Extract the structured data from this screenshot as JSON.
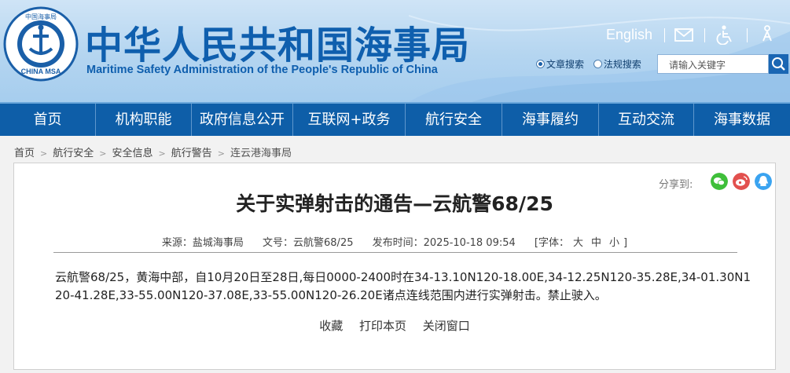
{
  "header": {
    "title_cn": "中华人民共和国海事局",
    "title_en": "Maritime Safety Administration of the People's Republic of China",
    "logo_text": "中国海事局 CHINA MSA",
    "english_link": "English",
    "icons": [
      "mail-icon",
      "accessibility-icon",
      "elder-mode-icon"
    ],
    "search": {
      "option_doc": "文章搜索",
      "option_law": "法规搜索",
      "placeholder": "请输入关键字"
    }
  },
  "nav": {
    "items": [
      "首页",
      "机构职能",
      "政府信息公开",
      "互联网+政务",
      "航行安全",
      "海事履约",
      "互动交流",
      "海事数据"
    ]
  },
  "breadcrumb": {
    "items": [
      "首页",
      "航行安全",
      "安全信息",
      "航行警告",
      "连云港海事局"
    ]
  },
  "article": {
    "share_label": "分享到:",
    "title": "关于实弹射击的通告—云航警68/25",
    "meta": {
      "source": "来源：盐城海事局",
      "doc_no": "文号：云航警68/25",
      "time": "发布时间：2025-10-18 09:54",
      "font_label": "[字体：",
      "font_large": "大",
      "font_medium": "中",
      "font_small": "小",
      "font_end": "]"
    },
    "body": "云航警68/25，黄海中部，自10月20日至28日,每日0000-2400时在34-13.10N120-18.00E,34-12.25N120-35.28E,34-01.30N120-41.28E,33-55.00N120-37.08E,33-55.00N120-26.20E诸点连线范围内进行实弹射击。禁止驶入。",
    "actions": [
      "收藏",
      "打印本页",
      "关闭窗口"
    ]
  },
  "colors": {
    "brand_blue": "#0f5fae",
    "nav_blue": "#0e5ea8",
    "wechat": "#3fbf3a",
    "weibo": "#e2504e",
    "qq": "#3aa3f0"
  }
}
